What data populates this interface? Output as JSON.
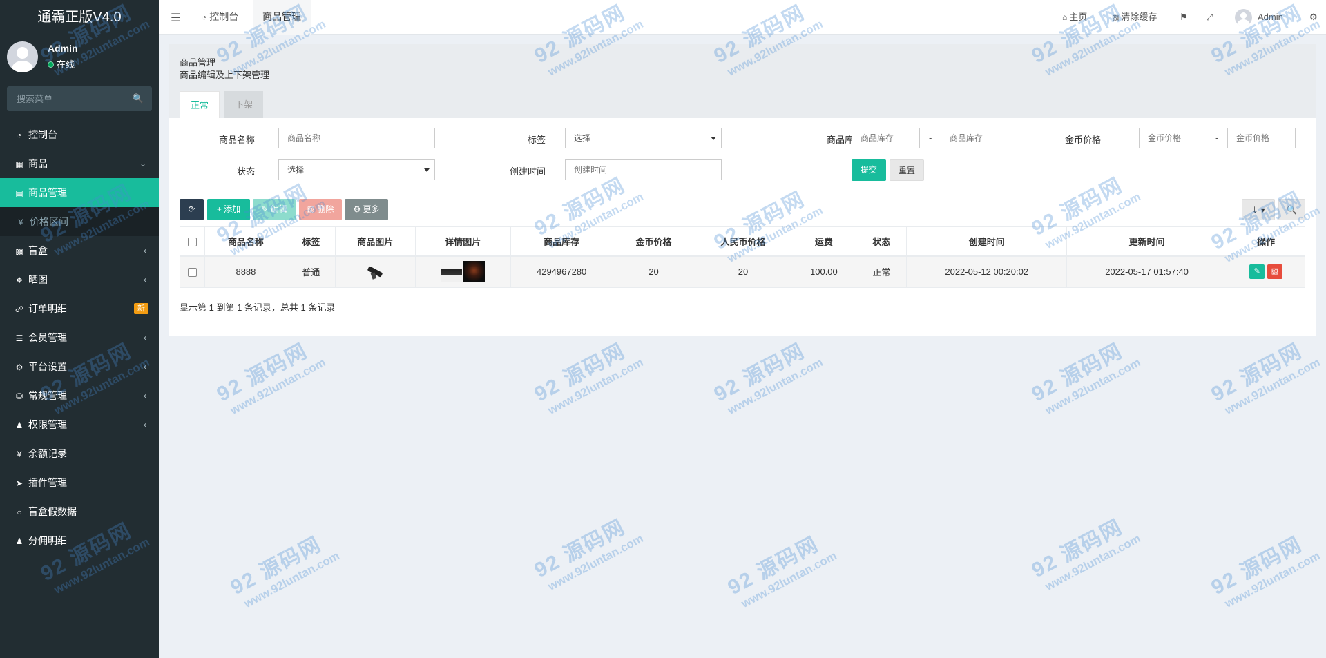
{
  "app": {
    "title": "通霸正版V4.0"
  },
  "user": {
    "name": "Admin",
    "status": "在线"
  },
  "sidebar": {
    "search_placeholder": "搜索菜单",
    "items": [
      {
        "label": "控制台",
        "icon": "dashboard-icon"
      },
      {
        "label": "商品",
        "icon": "shopping-bag-icon"
      },
      {
        "label": "商品管理",
        "icon": "shop-icon"
      },
      {
        "label": "价格区间",
        "icon": "yen-icon"
      },
      {
        "label": "盲盒",
        "icon": "cube-icon"
      },
      {
        "label": "晒图",
        "icon": "dropbox-icon"
      },
      {
        "label": "订单明细",
        "icon": "cart-icon",
        "badge": "新"
      },
      {
        "label": "会员管理",
        "icon": "list-icon"
      },
      {
        "label": "平台设置",
        "icon": "gear-icon"
      },
      {
        "label": "常规管理",
        "icon": "database-icon"
      },
      {
        "label": "权限管理",
        "icon": "group-icon"
      },
      {
        "label": "余额记录",
        "icon": "yen-icon"
      },
      {
        "label": "插件管理",
        "icon": "rocket-icon"
      },
      {
        "label": "盲盒假数据",
        "icon": "circle-icon"
      },
      {
        "label": "分佣明细",
        "icon": "users-icon"
      }
    ]
  },
  "topbar": {
    "tabs": [
      {
        "label": "控制台",
        "icon": "dashboard-icon"
      },
      {
        "label": "商品管理"
      }
    ],
    "home_label": "主页",
    "clear_cache_label": "清除缓存",
    "user_label": "Admin"
  },
  "panel": {
    "title": "商品管理",
    "subtitle": "商品编辑及上下架管理",
    "tabs": [
      "正常",
      "下架"
    ]
  },
  "filters": {
    "name_label": "商品名称",
    "name_placeholder": "商品名称",
    "tag_label": "标签",
    "tag_value": "选择",
    "stock_label": "商品库存",
    "stock_min_placeholder": "商品库存",
    "stock_max_placeholder": "商品库存",
    "coin_label": "金币价格",
    "coin_min_placeholder": "金币价格",
    "coin_max_placeholder": "金币价格",
    "status_label": "状态",
    "status_value": "选择",
    "created_label": "创建时间",
    "created_placeholder": "创建时间",
    "dash": "-",
    "submit_label": "提交",
    "reset_label": "重置"
  },
  "toolbar": {
    "add_label": "添加",
    "edit_label": "编辑",
    "delete_label": "删除",
    "more_label": "更多"
  },
  "table": {
    "headers": [
      "商品名称",
      "标签",
      "商品图片",
      "详情图片",
      "商品库存",
      "金币价格",
      "人民币价格",
      "运费",
      "状态",
      "创建时间",
      "更新时间",
      "操作"
    ],
    "rows": [
      {
        "name": "8888",
        "tag": "普通",
        "stock": "4294967280",
        "coin_price": "20",
        "rmb_price": "20",
        "shipping": "100.00",
        "status": "正常",
        "created": "2022-05-12 00:20:02",
        "updated": "2022-05-17 01:57:40"
      }
    ]
  },
  "pagination": {
    "summary": "显示第 1 到第 1 条记录，总共 1 条记录"
  },
  "watermark": {
    "big": "92 源码网",
    "small": "www.92luntan.com"
  },
  "colors": {
    "sidebar": "#222d32",
    "accent": "#18bc9c",
    "danger": "#e74c3c",
    "badge": "#f39c12",
    "dark_btn": "#2c3e50",
    "gray_btn": "#95a5a6"
  }
}
